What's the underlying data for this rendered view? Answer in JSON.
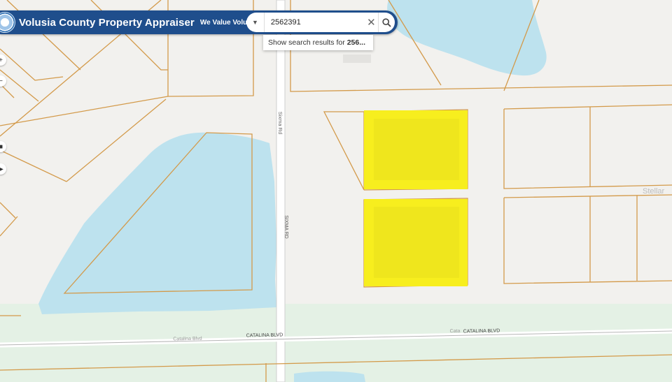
{
  "header": {
    "title": "Volusia County Property Appraiser",
    "tagline": "We Value Volusia!"
  },
  "search": {
    "value": "2562391",
    "dropdown_icon": "caret-down-icon",
    "clear_icon": "close-icon",
    "search_icon": "search-icon",
    "suggestion_prefix": "Show search results for",
    "suggestion_term": "256..."
  },
  "map": {
    "roads": {
      "sixma_upper": "Sixma Rd",
      "sixma_lower": "SIXMA RD",
      "catalina_left": "Catalina Blvd",
      "catalina_center": "CATALINA BLVD",
      "catalina_right_prefix": "Cata",
      "catalina_right": "CATALINA BLVD"
    },
    "partial_label": "Stellar",
    "colors": {
      "land": "#f2f1ee",
      "water": "#bde2ee",
      "parcel_line": "#d39a4a",
      "highlight": "#f7ee1e",
      "road": "#ffffff",
      "green_band": "#e3f0e3"
    }
  },
  "controls": [
    {
      "name": "zoom-in-control",
      "symbol": "+"
    },
    {
      "name": "zoom-out-control",
      "symbol": "−"
    },
    {
      "name": "stop-control",
      "symbol": "■"
    },
    {
      "name": "play-control",
      "symbol": "▶"
    }
  ]
}
